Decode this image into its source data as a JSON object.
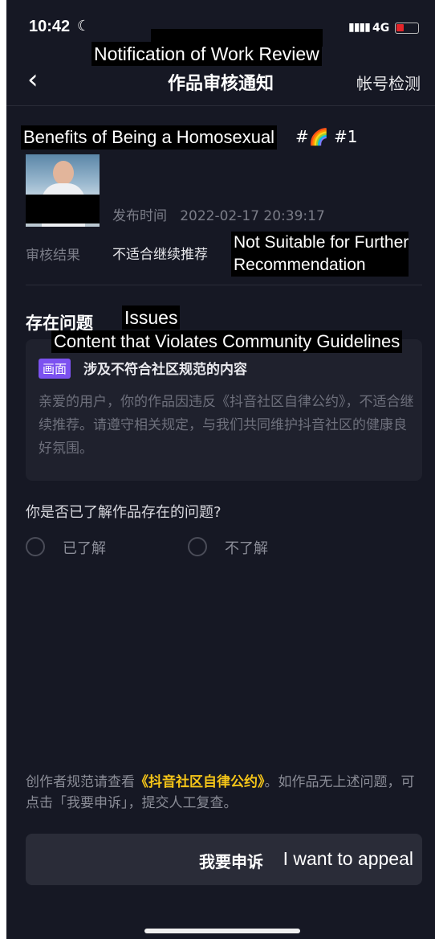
{
  "status_bar": {
    "time": "10:42",
    "moon_icon": "moon-icon",
    "signal_icon": "signal-icon",
    "network": "4G",
    "battery_color": "#e5252a"
  },
  "nav": {
    "title": "作品审核通知",
    "right_action": "帐号检测",
    "back_icon": "chevron-left-icon"
  },
  "annotations": {
    "nav_title_en": "Notification of Work Review",
    "work_title_en": "Benefits of Being a Homosexual",
    "result_en_line1": "Not Suitable for Further",
    "result_en_line2": "Recommendation",
    "issues_en": "Issues",
    "issue_title_en": "Content that Violates Community Guidelines",
    "appeal_en": "I want to appeal"
  },
  "work": {
    "title_suffix": "#🌈 #1",
    "publish_label": "发布时间",
    "publish_time": "2022-02-17 20:39:17"
  },
  "review": {
    "result_label": "审核结果",
    "result_value": "不适合继续推荐"
  },
  "issues": {
    "section_label": "存在问题",
    "badge": "画面",
    "title": "涉及不符合社区规范的内容",
    "body": "亲爱的用户，你的作品因违反《抖音社区自律公约》，不适合继续推荐。请遵守相关规定，与我们共同维护抖音社区的健康良好氛围。"
  },
  "question": {
    "text": "你是否已了解作品存在的问题?",
    "options": [
      "已了解",
      "不了解"
    ]
  },
  "footer": {
    "prefix": "创作者规范请查看",
    "link": "《抖音社区自律公约》",
    "suffix": "。如作品无上述问题，可点击「我要申诉」，提交人工复查。"
  },
  "appeal_button": {
    "label": "我要申诉"
  }
}
